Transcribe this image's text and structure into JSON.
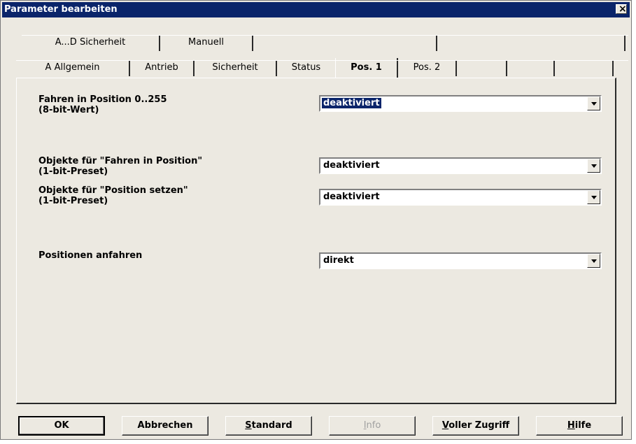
{
  "window": {
    "title": "Parameter bearbeiten",
    "close_glyph": "✕"
  },
  "tabs_row1": [
    {
      "label": "A...D  Sicherheit"
    },
    {
      "label": "Manuell"
    },
    {
      "label": ""
    },
    {
      "label": ""
    }
  ],
  "tabs_row2": [
    {
      "label": "A  Allgemein"
    },
    {
      "label": "Antrieb"
    },
    {
      "label": "Sicherheit"
    },
    {
      "label": "Status"
    },
    {
      "label": "Pos. 1",
      "active": true
    },
    {
      "label": "Pos. 2"
    },
    {
      "label": ""
    },
    {
      "label": ""
    },
    {
      "label": ""
    }
  ],
  "params": {
    "fahren_position": {
      "label_line1": "Fahren in Position 0..255",
      "label_line2": "(8-bit-Wert)",
      "value": "deaktiviert"
    },
    "objekte_fahren": {
      "label_line1": "Objekte für \"Fahren in Position\"",
      "label_line2": "(1-bit-Preset)",
      "value": "deaktiviert"
    },
    "objekte_setzen": {
      "label_line1": "Objekte für \"Position setzen\"",
      "label_line2": "(1-bit-Preset)",
      "value": "deaktiviert"
    },
    "positionen_anfahren": {
      "label_line1": "Positionen anfahren",
      "value": "direkt"
    }
  },
  "buttons": {
    "ok": "OK",
    "abbrechen": "Abbrechen",
    "standard_underlined": "S",
    "standard_rest": "tandard",
    "info_underlined": "I",
    "info_rest": "nfo",
    "voller_underlined": "V",
    "voller_rest": "oller Zugriff",
    "hilfe_underlined": "H",
    "hilfe_rest": "ilfe"
  },
  "icons": {
    "close": "close-icon",
    "dropdown": "chevron-down-icon"
  },
  "colors": {
    "titlebar": "#0a246a",
    "dialog": "#ece9e1",
    "selection": "#0a246a"
  }
}
